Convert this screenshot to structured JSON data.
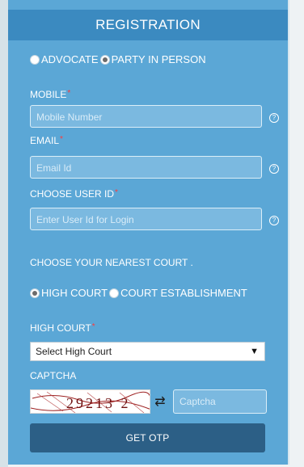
{
  "header": {
    "title": "REGISTRATION"
  },
  "user_type": {
    "options": [
      {
        "label": "ADVOCATE",
        "checked": false
      },
      {
        "label": "PARTY IN PERSON",
        "checked": true
      }
    ]
  },
  "fields": {
    "mobile": {
      "label": "MOBILE",
      "required_mark": "*",
      "placeholder": "Mobile Number"
    },
    "email": {
      "label": "EMAIL",
      "required_mark": "*",
      "placeholder": "Email Id"
    },
    "user_id": {
      "label": "CHOOSE USER ID",
      "required_mark": "*",
      "placeholder": "Enter User Id for Login"
    }
  },
  "court_prompt": "CHOOSE YOUR NEAREST COURT .",
  "court_type": {
    "options": [
      {
        "label": "HIGH COURT",
        "checked": true
      },
      {
        "label": "COURT ESTABLISHMENT",
        "checked": false
      }
    ]
  },
  "high_court": {
    "label": "HIGH COURT",
    "required_mark": "*",
    "selected": "Select High Court"
  },
  "captcha": {
    "label": "CAPTCHA",
    "image_text": "29213 2",
    "placeholder": "Captcha",
    "refresh_icon": "refresh-icon"
  },
  "actions": {
    "get_otp": "GET OTP"
  },
  "colors": {
    "panel": "#5ba7d6",
    "header": "#3b8ac0",
    "button": "#2c5f86",
    "required": "#ff3b3b"
  }
}
